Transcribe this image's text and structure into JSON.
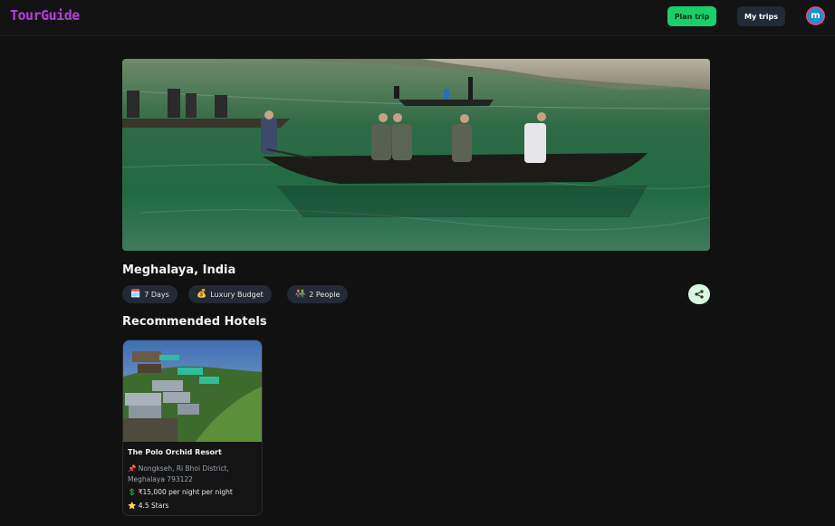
{
  "header": {
    "logo": "TourGuide",
    "plan_trip": "Plan trip",
    "my_trips": "My trips",
    "avatar_initial": "m"
  },
  "trip": {
    "destination": "Meghalaya, India",
    "chips": [
      {
        "icon": "calendar-icon",
        "glyph": "🗓️",
        "label": "7 Days"
      },
      {
        "icon": "money-bag-icon",
        "glyph": "💰",
        "label": "Luxury Budget"
      },
      {
        "icon": "people-icon",
        "glyph": "👫",
        "label": "2 People"
      }
    ]
  },
  "hotels": {
    "section_title": "Recommended Hotels",
    "items": [
      {
        "name": "The Polo Orchid Resort",
        "address_icon": "📌",
        "address": "Nongkseh, Ri Bhoi District, Meghalaya 793122",
        "price_icon": "💲",
        "price": "₹15,000 per night per night",
        "rating_icon": "⭐",
        "rating": "4.5 Stars"
      }
    ]
  },
  "colors": {
    "background": "#111111",
    "logo": "#b63ee0",
    "plan_button": "#16d16a",
    "chip_bg": "#222a36",
    "share_bg": "#d7f7e1"
  }
}
